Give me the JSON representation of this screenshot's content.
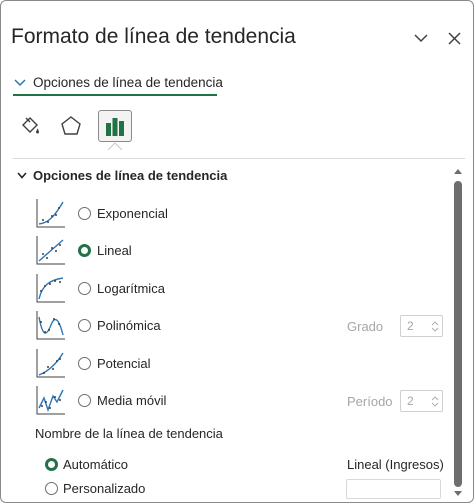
{
  "pane": {
    "title": "Formato de línea de tendencia"
  },
  "tab": {
    "label": "Opciones de línea de tendencia"
  },
  "icons": {
    "fill_line": "paint-bucket-icon",
    "effects": "pentagon-icon",
    "options": "bar-chart-icon"
  },
  "section": {
    "title": "Opciones de línea de tendencia"
  },
  "types": [
    {
      "label": "Exponencial",
      "checked": false
    },
    {
      "label": "Lineal",
      "checked": true
    },
    {
      "label": "Logarítmica",
      "checked": false
    },
    {
      "label": "Polinómica",
      "checked": false
    },
    {
      "label": "Potencial",
      "checked": false
    },
    {
      "label": "Media móvil",
      "checked": false
    }
  ],
  "order": {
    "label": "Grado",
    "value": "2"
  },
  "period": {
    "label": "Período",
    "value": "2"
  },
  "name_section": {
    "title": "Nombre de la línea de tendencia",
    "automatic_label": "Automático",
    "automatic_value": "Lineal (Ingresos)",
    "custom_label": "Personalizado",
    "custom_value": ""
  },
  "colors": {
    "accent": "#217346",
    "chart_blue": "#2e75b6",
    "text": "#262626",
    "disabled": "#a6a6a6"
  }
}
